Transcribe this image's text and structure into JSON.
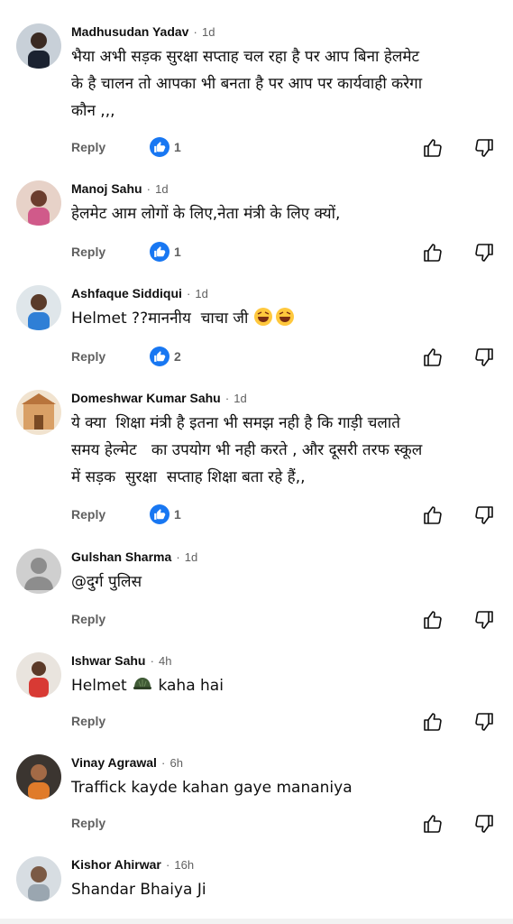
{
  "comments": [
    {
      "author": "Madhusudan Yadav",
      "sep": "·",
      "time": "1d",
      "text": "भैया अभी सड़क सुरक्षा सप्ताह चल रहा है पर आप बिना हेलमेट\nके है चालन तो आपका भी बनता है पर आप पर कार्यवाही करेगा\nकौन ,,,",
      "reply": "Reply",
      "likes": "1",
      "avatar": "person-dark"
    },
    {
      "author": "Manoj Sahu",
      "sep": "·",
      "time": "1d",
      "text": "हेलमेट आम लोगों के लिए,नेता मंत्री के लिए क्यों,",
      "reply": "Reply",
      "likes": "1",
      "avatar": "person-pink"
    },
    {
      "author": "Ashfaque Siddiqui",
      "sep": "·",
      "time": "1d",
      "text_prefix": "Helmet ??माननीय  चाचा जी ",
      "emoji": "😂😂",
      "reply": "Reply",
      "likes": "2",
      "avatar": "person-blue"
    },
    {
      "author": "Domeshwar Kumar Sahu",
      "sep": "·",
      "time": "1d",
      "text": "ये क्या  शिक्षा मंत्री है इतना भी समझ नही है कि गाड़ी चलाते\nसमय हेल्मेट   का उपयोग भी नही करते , और दूसरी तरफ स्कूल\nमें सड़क  सुरक्षा  सप्ताह शिक्षा बता रहे हैं,,",
      "reply": "Reply",
      "likes": "1",
      "avatar": "temple"
    },
    {
      "author": "Gulshan Sharma",
      "sep": "·",
      "time": "1d",
      "text": "@दुर्ग पुलिस",
      "reply": "Reply",
      "avatar": "default"
    },
    {
      "author": "Ishwar Sahu",
      "sep": "·",
      "time": "4h",
      "text_prefix": "Helmet ",
      "emoji": "⛑️",
      "text_suffix": " kaha hai",
      "reply": "Reply",
      "avatar": "person-red"
    },
    {
      "author": "Vinay Agrawal",
      "sep": "·",
      "time": "6h",
      "text": "Traffick kayde kahan gaye mananiya",
      "reply": "Reply",
      "avatar": "person-orange"
    },
    {
      "author": "Kishor Ahirwar",
      "sep": "·",
      "time": "16h",
      "text": "Shandar Bhaiya Ji",
      "avatar": "person-grey"
    }
  ],
  "colors": {
    "like_badge": "#1877f2",
    "secondary_text": "#606060"
  },
  "icons": {
    "like_badge": "thumbs-up-badge-icon",
    "like": "thumb-up-icon",
    "dislike": "thumb-down-icon"
  }
}
